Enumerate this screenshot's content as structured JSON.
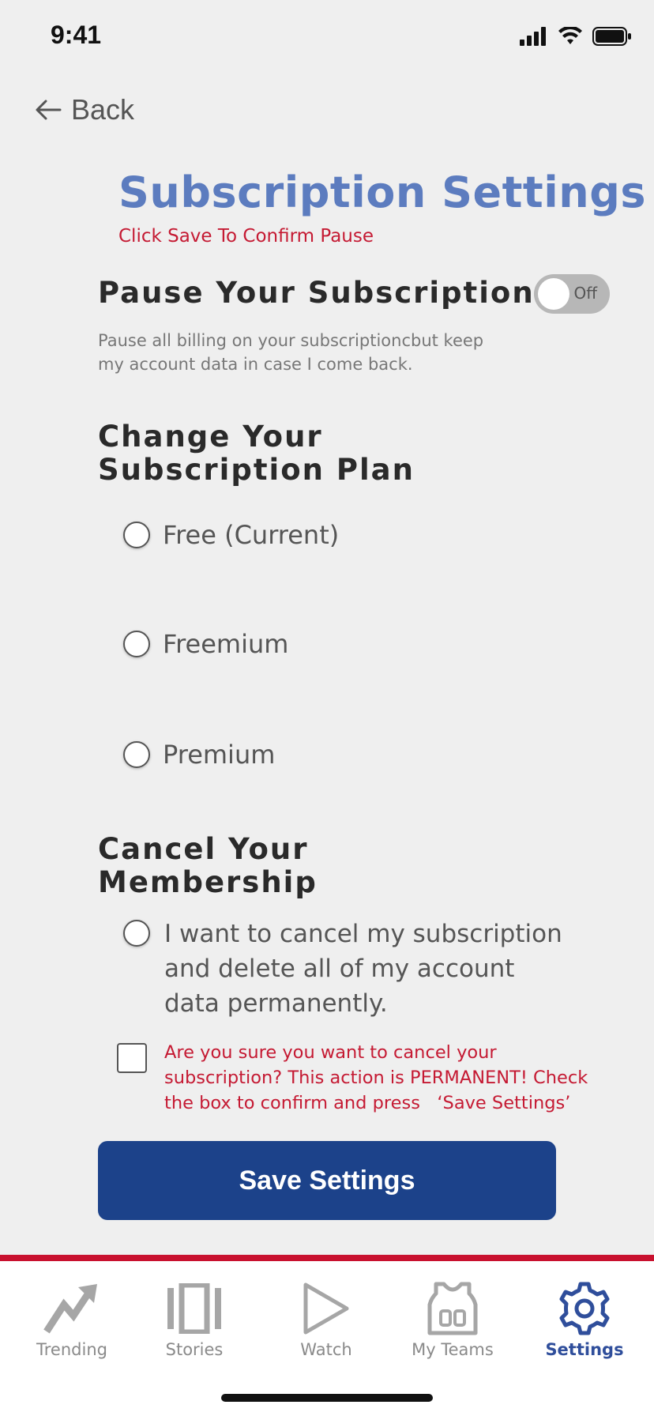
{
  "status_bar": {
    "time": "9:41"
  },
  "nav": {
    "back_label": "Back"
  },
  "header": {
    "title": "Subscription Settings",
    "subtitle": "Click Save To Confirm Pause"
  },
  "pause": {
    "heading": "Pause Your Subscription",
    "description": "Pause all billing on your subscriptioncbut keep my account data in case I come back.",
    "toggle_state": "Off"
  },
  "plan": {
    "heading": "Change Your Subscription Plan",
    "options": [
      {
        "label": "Free (Current)"
      },
      {
        "label": "Freemium"
      },
      {
        "label": "Premium"
      }
    ]
  },
  "cancel": {
    "heading": "Cancel Your Membership",
    "option_label": "I want to cancel my subscription and delete all of my account data permanently.",
    "warning": "Are you sure you want to cancel your subscription? This action is PERMANENT! Check the box to confirm and press   ‘Save Settings’"
  },
  "actions": {
    "save_label": "Save Settings"
  },
  "tabs": [
    {
      "label": "Trending",
      "icon": "trending-icon"
    },
    {
      "label": "Stories",
      "icon": "stories-icon"
    },
    {
      "label": "Watch",
      "icon": "play-icon"
    },
    {
      "label": "My Teams",
      "icon": "jersey-icon"
    },
    {
      "label": "Settings",
      "icon": "gear-icon",
      "active": true
    }
  ],
  "colors": {
    "accent": "#1c428a",
    "title": "#5c7cbf",
    "alert": "#c51a33",
    "tab_active": "#2f4e9b"
  }
}
